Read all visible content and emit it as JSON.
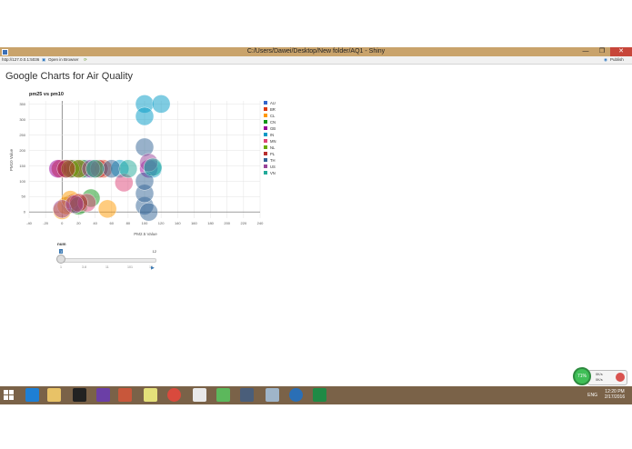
{
  "window": {
    "title": "C:/Users/Dawei/Desktop/New folder/AQ1 - Shiny",
    "url": "http://127.0.0.1:5036",
    "open_in_browser": "Open in Browser",
    "publish": "Publish",
    "btn_min": "—",
    "btn_max": "❐",
    "btn_close": "✕"
  },
  "page": {
    "title": "Google Charts for Air Quality"
  },
  "chart_data": {
    "type": "scatter",
    "title": "pm25 vs pm10",
    "xlabel": "PM2.5 Value",
    "ylabel": "PM10 Value",
    "xlim": [
      -40,
      240
    ],
    "ylim": [
      -20,
      360
    ],
    "xticks": [
      -40,
      -20,
      0,
      20,
      40,
      60,
      80,
      100,
      120,
      140,
      160,
      180,
      200,
      220,
      240
    ],
    "yticks": [
      0,
      50,
      100,
      150,
      200,
      250,
      300,
      350
    ],
    "legend_position": "right",
    "series": [
      {
        "name": "AU",
        "color": "#3366cc",
        "points": [
          [
            5,
            140
          ],
          [
            10,
            25
          ],
          [
            30,
            140
          ]
        ]
      },
      {
        "name": "BR",
        "color": "#dc3912",
        "points": [
          [
            -2,
            140
          ],
          [
            15,
            30
          ],
          [
            50,
            140
          ]
        ]
      },
      {
        "name": "CL",
        "color": "#ff9900",
        "points": [
          [
            0,
            5
          ],
          [
            5,
            20
          ],
          [
            55,
            10
          ],
          [
            10,
            40
          ]
        ]
      },
      {
        "name": "CN",
        "color": "#109618",
        "points": [
          [
            15,
            140
          ],
          [
            25,
            140
          ],
          [
            20,
            20
          ],
          [
            35,
            45
          ]
        ]
      },
      {
        "name": "GB",
        "color": "#990099",
        "points": [
          [
            -5,
            140
          ],
          [
            12,
            140
          ],
          [
            105,
            140
          ]
        ]
      },
      {
        "name": "IN",
        "color": "#0099c6",
        "points": [
          [
            100,
            350
          ],
          [
            120,
            350
          ],
          [
            100,
            310
          ],
          [
            70,
            140
          ],
          [
            110,
            140
          ]
        ]
      },
      {
        "name": "MN",
        "color": "#dd4477",
        "points": [
          [
            30,
            30
          ],
          [
            75,
            95
          ],
          [
            20,
            140
          ]
        ]
      },
      {
        "name": "NL",
        "color": "#66aa00",
        "points": [
          [
            10,
            140
          ],
          [
            20,
            140
          ],
          [
            40,
            140
          ]
        ]
      },
      {
        "name": "PL",
        "color": "#b82e2e",
        "points": [
          [
            5,
            140
          ],
          [
            20,
            30
          ],
          [
            45,
            140
          ]
        ]
      },
      {
        "name": "TH",
        "color": "#316395",
        "points": [
          [
            60,
            140
          ],
          [
            100,
            20
          ],
          [
            100,
            60
          ],
          [
            100,
            100
          ],
          [
            100,
            210
          ],
          [
            105,
            0
          ]
        ]
      },
      {
        "name": "US",
        "color": "#994499",
        "points": [
          [
            0,
            10
          ],
          [
            15,
            25
          ],
          [
            35,
            140
          ],
          [
            105,
            160
          ]
        ]
      },
      {
        "name": "VN",
        "color": "#22aa99",
        "points": [
          [
            40,
            140
          ],
          [
            80,
            140
          ],
          [
            110,
            145
          ]
        ]
      }
    ]
  },
  "slider": {
    "label": "num",
    "min_label": "1",
    "max_label": "12",
    "ticks": [
      "1",
      "3.8",
      "11",
      "101",
      "12"
    ],
    "play_icon": "play-icon"
  },
  "widget": {
    "percent": "71%",
    "up": "0K/s",
    "down": "0K/s"
  },
  "taskbar": {
    "lang": "ENG",
    "time": "12:20 PM",
    "date": "2/17/2016"
  }
}
